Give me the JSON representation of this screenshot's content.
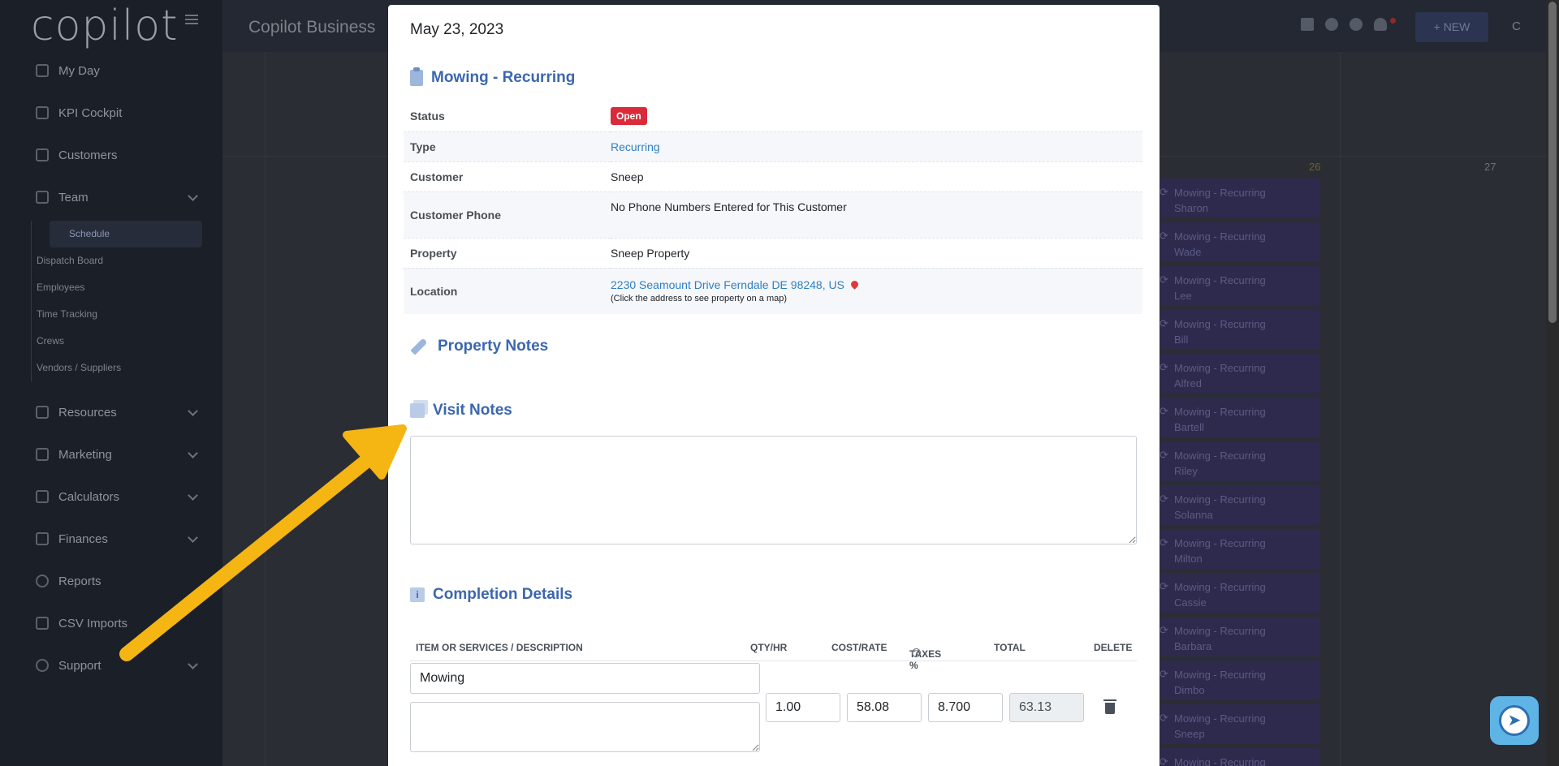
{
  "sidebar": {
    "logo": "copilot",
    "items": [
      {
        "label": "My Day",
        "icon": "grid-icon"
      },
      {
        "label": "KPI Cockpit",
        "icon": "bar-chart-icon"
      },
      {
        "label": "Customers",
        "icon": "users-icon"
      },
      {
        "label": "Team",
        "icon": "team-icon"
      },
      {
        "label": "Resources",
        "icon": "book-icon"
      },
      {
        "label": "Marketing",
        "icon": "megaphone-icon"
      },
      {
        "label": "Calculators",
        "icon": "calculator-icon"
      },
      {
        "label": "Finances",
        "icon": "money-icon"
      },
      {
        "label": "Reports",
        "icon": "pie-chart-icon"
      },
      {
        "label": "CSV Imports",
        "icon": "file-icon"
      },
      {
        "label": "Support",
        "icon": "lifebuoy-icon"
      }
    ],
    "team_subitems": [
      "Schedule",
      "Dispatch Board",
      "Employees",
      "Time Tracking",
      "Crews",
      "Vendors / Suppliers"
    ]
  },
  "header": {
    "title": "Copilot Business",
    "new_button": "+ NEW",
    "user_initial": "C"
  },
  "calendar": {
    "day_numbers": [
      "26",
      "27"
    ],
    "events": [
      {
        "title": "Mowing - Recurring",
        "name": "Sharon"
      },
      {
        "title": "Mowing - Recurring",
        "name": "Wade"
      },
      {
        "title": "Mowing - Recurring",
        "name": "Lee"
      },
      {
        "title": "Mowing - Recurring",
        "name": "Bill"
      },
      {
        "title": "Mowing - Recurring",
        "name": "Alfred"
      },
      {
        "title": "Mowing - Recurring",
        "name": "Bartell"
      },
      {
        "title": "Mowing - Recurring",
        "name": "Riley"
      },
      {
        "title": "Mowing - Recurring",
        "name": "Solanna"
      },
      {
        "title": "Mowing - Recurring",
        "name": "Milton"
      },
      {
        "title": "Mowing - Recurring",
        "name": "Cassie"
      },
      {
        "title": "Mowing - Recurring",
        "name": "Barbara"
      },
      {
        "title": "Mowing - Recurring",
        "name": "Dimbo"
      },
      {
        "title": "Mowing - Recurring",
        "name": "Sneep"
      },
      {
        "title": "Mowing - Recurring",
        "name": ""
      }
    ]
  },
  "modal": {
    "date": "May 23, 2023",
    "visit_title": "Mowing - Recurring",
    "details": {
      "status_label": "Status",
      "status_value": "Open",
      "type_label": "Type",
      "type_value": "Recurring",
      "customer_label": "Customer",
      "customer_value": "Sneep",
      "phone_label": "Customer Phone",
      "phone_value": "No Phone Numbers Entered for This Customer",
      "property_label": "Property",
      "property_value": "Sneep Property",
      "location_label": "Location",
      "location_value": "2230 Seamount Drive Ferndale DE 98248, US",
      "location_hint": "(Click the address to see property on a map)"
    },
    "property_notes_title": "Property Notes",
    "visit_notes_title": "Visit Notes",
    "visit_notes_value": "",
    "completion_title": "Completion Details",
    "columns": {
      "item": "ITEM OR SERVICES / DESCRIPTION",
      "qty": "QTY/HR",
      "cost": "COST/RATE",
      "taxes": "TAXES %",
      "total": "TOTAL",
      "delete": "DELETE"
    },
    "line_item": {
      "item": "Mowing",
      "description": "",
      "qty": "1.00",
      "cost": "58.08",
      "taxes": "8.700",
      "total": "63.13"
    }
  },
  "colors": {
    "accent": "#3b67ae",
    "status_open": "#d92b3a",
    "arrow": "#f5b512"
  }
}
